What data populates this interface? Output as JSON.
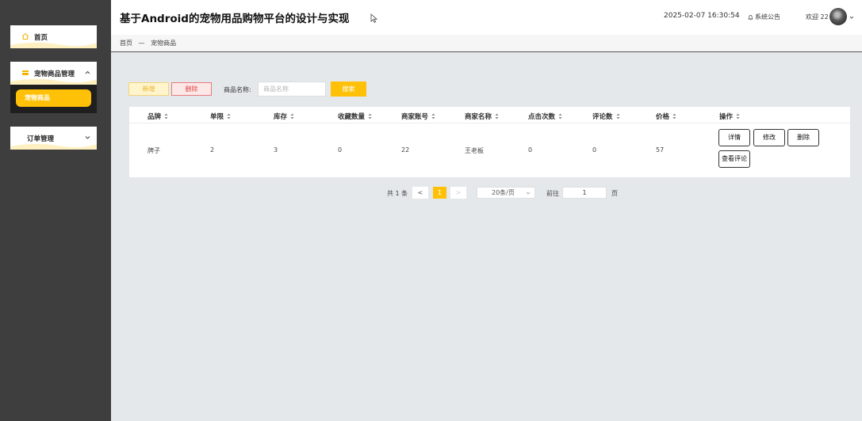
{
  "sidebar": {
    "home_label": "首页",
    "pet_goods_menu_label": "宠物商品管理",
    "pet_goods_sub_label": "宠物商品",
    "order_menu_label": "订单管理"
  },
  "header": {
    "title": "基于Android的宠物用品购物平台的设计与实现",
    "datetime": "2025-02-07 16:30:54",
    "notice_label": "系统公告",
    "welcome_label": "欢迎 22"
  },
  "breadcrumb": {
    "home": "首页",
    "separator": "—",
    "current": "宠物商品"
  },
  "toolbar": {
    "add_label": "新增",
    "delete_label": "删除",
    "search_label": "商品名称:",
    "search_placeholder": "商品名称",
    "search_button": "搜索"
  },
  "table": {
    "columns": [
      "品牌",
      "单限",
      "库存",
      "收藏数量",
      "商家账号",
      "商家名称",
      "点击次数",
      "评论数",
      "价格",
      "操作"
    ],
    "rows": [
      {
        "cells": [
          "牌子",
          "2",
          "3",
          "0",
          "22",
          "王老板",
          "0",
          "0",
          "57"
        ],
        "actions": [
          "详情",
          "修改",
          "删除",
          "查看评论"
        ]
      }
    ]
  },
  "pagination": {
    "total": "共 1 条",
    "prev": "<",
    "current": "1",
    "next": ">",
    "page_size": "20条/页",
    "goto_label": "前往",
    "goto_value": "1",
    "page_suffix": "页"
  },
  "colors": {
    "accent": "#ffc107",
    "sidebar_bg": "#3e3e3e",
    "danger": "#e04545"
  }
}
